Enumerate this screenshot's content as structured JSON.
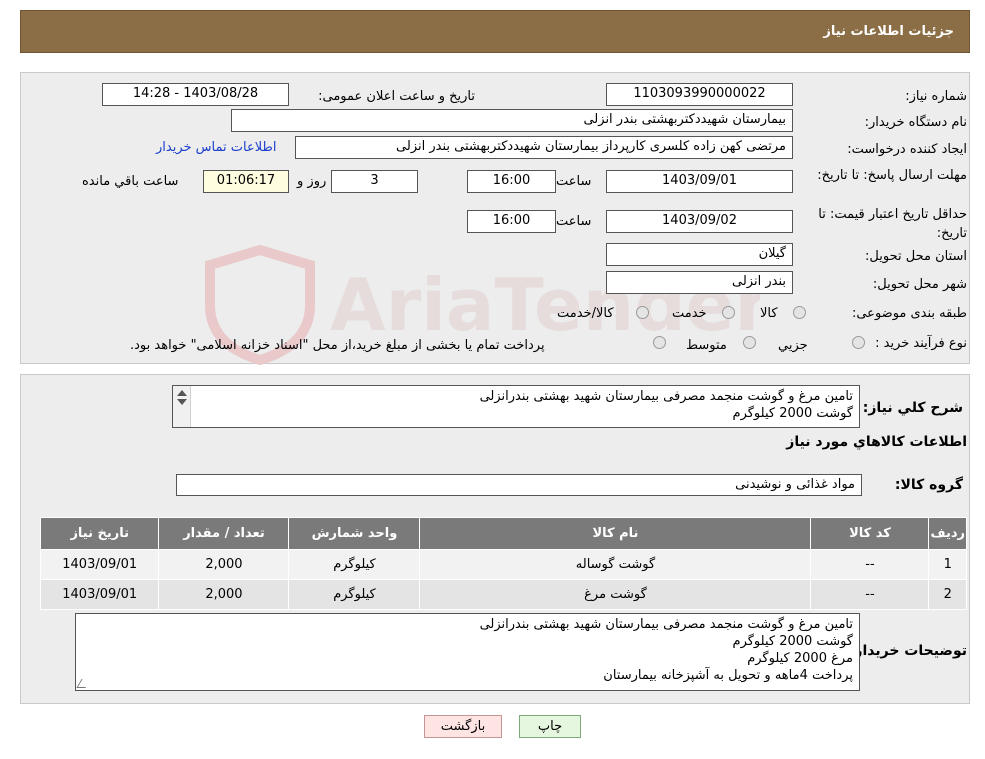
{
  "header": {
    "title": "جزئیات اطلاعات نیاز"
  },
  "form": {
    "need_number_label": "شماره نیاز:",
    "need_number": "1103093990000022",
    "announce_label": "تاریخ و ساعت اعلان عمومی:",
    "announce_value": "1403/08/28 - 14:28",
    "buyer_org_label": "نام دستگاه خریدار:",
    "buyer_org": "بیمارستان شهیددکتربهشتی بندر انزلی",
    "creator_label": "ایجاد کننده درخواست:",
    "creator": "مرتضی کهن زاده کلسری کارپرداز بیمارستان شهیددکتربهشتی بندر انزلی",
    "contact_link": "اطلاعات تماس خریدار",
    "deadline_label": "مهلت ارسال پاسخ: تا تاریخ:",
    "deadline_date": "1403/09/01",
    "time_label": "ساعت",
    "deadline_time": "16:00",
    "days_value": "3",
    "days_label": "روز و",
    "remaining_time": "01:06:17",
    "remaining_label": "ساعت باقي مانده",
    "validity_label": "حداقل تاریخ اعتبار قیمت: تا تاریخ:",
    "validity_date": "1403/09/02",
    "validity_time": "16:00",
    "province_label": "استان محل تحویل:",
    "province": "گیلان",
    "city_label": "شهر محل تحویل:",
    "city": "بندر انزلی",
    "category_label": "طبقه بندی موضوعی:",
    "category_options": [
      "کالا",
      "خدمت",
      "کالا/خدمت"
    ],
    "process_label": "نوع فرآیند خرید :",
    "process_options": [
      "جزیي",
      "متوسط"
    ],
    "process_note": "پرداخت تمام یا بخشی از مبلغ خرید،از محل \"اسناد خزانه اسلامی\" خواهد بود."
  },
  "summary": {
    "label": "شرح کلي نياز:",
    "lines": [
      "تامین مرغ و گوشت منجمد مصرفی بیمارستان شهید بهشتی بندرانزلی",
      "گوشت 2000 کیلوگرم"
    ]
  },
  "goods": {
    "section_title": "اطلاعات کالاهاي مورد نياز",
    "group_label": "گروه کالا:",
    "group_value": "مواد غذائی و نوشیدنی"
  },
  "table": {
    "headers": [
      "رديف",
      "کد کالا",
      "نام کالا",
      "واحد شمارش",
      "تعداد / مقدار",
      "تاريخ نياز"
    ],
    "rows": [
      [
        "1",
        "--",
        "گوشت گوساله",
        "کیلوگرم",
        "2,000",
        "1403/09/01"
      ],
      [
        "2",
        "--",
        "گوشت مرغ",
        "کیلوگرم",
        "2,000",
        "1403/09/01"
      ]
    ]
  },
  "buyer_notes": {
    "label": "توضيحات خريدار:",
    "lines": [
      "تامین مرغ و گوشت منجمد مصرفی بیمارستان شهید بهشتی بندرانزلی",
      "گوشت 2000 کیلوگرم",
      "مرغ 2000 کیلوگرم",
      "پرداخت 4ماهه و تحویل به آشپزخانه بیمارستان"
    ]
  },
  "buttons": {
    "print": "چاپ",
    "back": "بازگشت"
  },
  "watermark": {
    "text": "AriaTender.neT"
  }
}
